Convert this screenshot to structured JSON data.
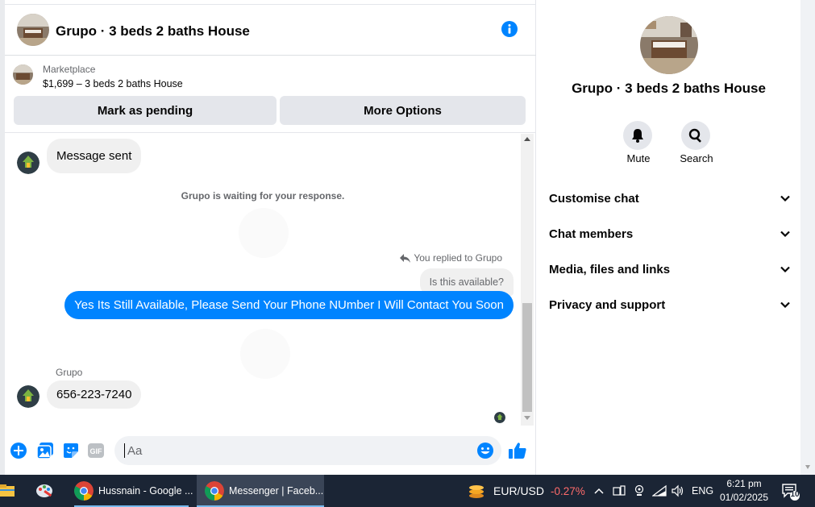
{
  "header": {
    "title": "Grupo · 3 beds 2 baths House",
    "info_icon": "info-icon"
  },
  "marketplace": {
    "label": "Marketplace",
    "listing": "$1,699 – 3 beds 2 baths House",
    "mark_pending": "Mark as pending",
    "more_options": "More Options"
  },
  "messages": {
    "sent_bubble": "Message sent",
    "waiting_note": "Grupo is waiting for your response.",
    "replied_note": "You replied to Grupo",
    "quoted": "Is this available?",
    "my_reply": "Yes Its Still Available, Please Send Your Phone NUmber I Will Contact You Soon",
    "sender_name": "Grupo",
    "phone_message": "656-223-7240"
  },
  "composer": {
    "placeholder": "Aa",
    "icons": [
      "plus-circle-icon",
      "photo-icon",
      "sticker-icon",
      "gif-icon",
      "emoji-icon",
      "thumbs-up-icon"
    ]
  },
  "info_panel": {
    "title": "Grupo · 3 beds 2 baths House",
    "mute_label": "Mute",
    "search_label": "Search",
    "sections": [
      "Customise chat",
      "Chat members",
      "Media, files and links",
      "Privacy and support"
    ]
  },
  "taskbar": {
    "apps": [
      "Hussnain - Google ...",
      "Messenger | Faceb..."
    ],
    "ticker_name": "EUR/USD",
    "ticker_change": "-0.27%",
    "language": "ENG",
    "time": "6:21 pm",
    "date": "01/02/2025",
    "notifications": "10"
  },
  "colors": {
    "accent": "#0084ff",
    "button_gray": "#e4e6eb",
    "taskbar": "#1b2535",
    "ticker_red": "#ff6b6b"
  }
}
